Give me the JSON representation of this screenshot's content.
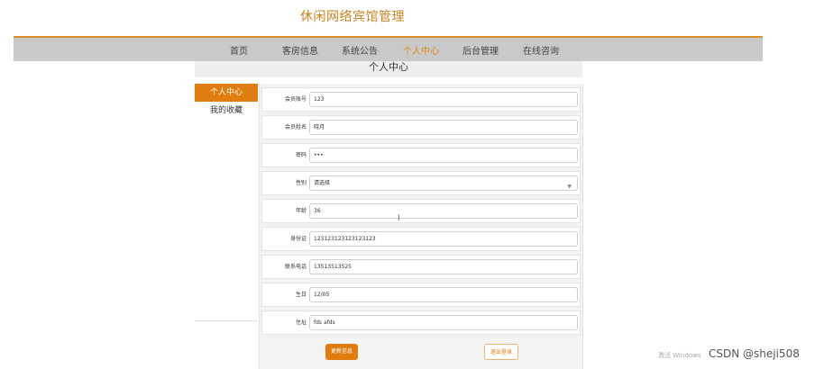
{
  "site_title": "休闲网络宾馆管理",
  "nav": {
    "items": [
      {
        "label": "首页"
      },
      {
        "label": "客房信息"
      },
      {
        "label": "系统公告"
      },
      {
        "label": "个人中心"
      },
      {
        "label": "后台管理"
      },
      {
        "label": "在线咨询"
      }
    ],
    "active": "个人中心",
    "border_color": "#d8912a",
    "active_color": "#e08a12"
  },
  "page_header": {
    "title": "个人中心"
  },
  "sidebar": {
    "items": [
      {
        "label": "个人中心"
      },
      {
        "label": "我的收藏"
      }
    ],
    "active": "个人中心"
  },
  "form": {
    "fields": [
      {
        "label": "会员账号",
        "value": "123"
      },
      {
        "label": "会员姓名",
        "value": "晓月"
      },
      {
        "label": "密码",
        "value": "•••"
      },
      {
        "label": "性别",
        "value": "请选择"
      },
      {
        "label": "年龄",
        "value": "36"
      },
      {
        "label": "身份证",
        "value": "123123123123123123"
      },
      {
        "label": "联系电话",
        "value": "13513513525"
      },
      {
        "label": "生日",
        "value": "12/05"
      },
      {
        "label": "住址",
        "value": "fds afds"
      }
    ],
    "update_button": "更新信息",
    "logout_button": "退出登录"
  },
  "overlay": {
    "watermark": "激活 Windows",
    "credit": "CSDN @sheji508"
  },
  "accent_color": "#e07d10"
}
